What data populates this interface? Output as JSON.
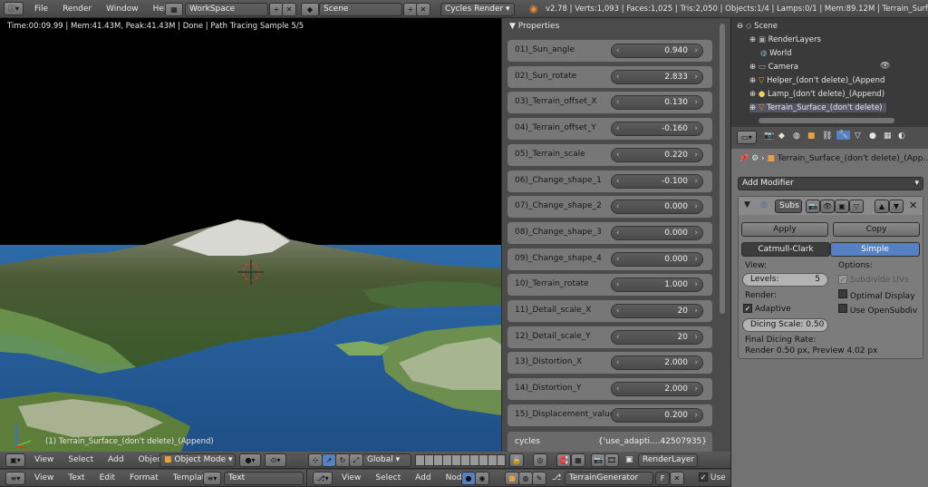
{
  "topbar": {
    "menus": [
      "File",
      "Render",
      "Window",
      "Help"
    ],
    "workspace": "WorkSpace",
    "scene": "Scene",
    "engine": "Cycles Render",
    "stats": "v2.78 | Verts:1,093 | Faces:1,025 | Tris:2,050 | Objects:1/4 | Lamps:0/1 | Mem:89.12M | Terrain_Surface_(don"
  },
  "viewport": {
    "info": "Time:00:09.99 | Mem:41.43M, Peak:41.43M | Done | Path Tracing Sample 5/5",
    "object_label": "(1) Terrain_Surface_(don't delete)_(Append)"
  },
  "props": {
    "title": "Properties",
    "rows": [
      {
        "label": "01)_Sun_angle",
        "value": "0.940"
      },
      {
        "label": "02)_Sun_rotate",
        "value": "2.833"
      },
      {
        "label": "03)_Terrain_offset_X",
        "value": "0.130"
      },
      {
        "label": "04)_Terrain_offset_Y",
        "value": "-0.160"
      },
      {
        "label": "05)_Terrain_scale",
        "value": "0.220"
      },
      {
        "label": "06)_Change_shape_1",
        "value": "-0.100"
      },
      {
        "label": "07)_Change_shape_2",
        "value": "0.000"
      },
      {
        "label": "08)_Change_shape_3",
        "value": "0.000"
      },
      {
        "label": "09)_Change_shape_4",
        "value": "0.000"
      },
      {
        "label": "10)_Terrain_rotate",
        "value": "1.000"
      },
      {
        "label": "11)_Detail_scale_X",
        "value": "20"
      },
      {
        "label": "12)_Detail_scale_Y",
        "value": "20"
      },
      {
        "label": "13)_Distortion_X",
        "value": "2.000"
      },
      {
        "label": "14)_Distortion_Y",
        "value": "2.000"
      },
      {
        "label": "15)_Displacement_value",
        "value": "0.200"
      }
    ],
    "cycles_label": "cycles",
    "cycles_value": "{'use_adapti....42507935}"
  },
  "viewheader": {
    "menus": [
      "View",
      "Select",
      "Add",
      "Object"
    ],
    "mode": "Object Mode",
    "orientation": "Global",
    "renderlayer": "RenderLayer"
  },
  "textheader": {
    "menus": [
      "View",
      "Text",
      "Edit",
      "Format",
      "Templates"
    ],
    "textname": "Text"
  },
  "nodeheader": {
    "menus": [
      "View",
      "Select",
      "Add",
      "Node"
    ],
    "nodename": "TerrainGenerator",
    "fake": "F",
    "use": "Use"
  },
  "outliner": {
    "items": [
      "Scene",
      "RenderLayers",
      "World",
      "Camera",
      "Helper_(don't delete)_(Append",
      "Lamp_(don't delete)_(Append)",
      "Terrain_Surface_(don't delete)"
    ]
  },
  "modifier": {
    "breadcrumb": "Terrain_Surface_(don't delete)_(App...",
    "add_modifier": "Add Modifier",
    "name": "Subs",
    "apply": "Apply",
    "copy": "Copy",
    "tab_cc": "Catmull-Clark",
    "tab_simple": "Simple",
    "view_label": "View:",
    "levels": "Levels:",
    "levels_value": "5",
    "render_label": "Render:",
    "adaptive": "Adaptive",
    "dicing": "Dicing Scale:",
    "dicing_value": "0.50",
    "options_label": "Options:",
    "subdivide_uvs": "Subdivide UVs",
    "optimal_display": "Optimal Display",
    "use_opensubdiv": "Use OpenSubdiv",
    "final_rate_label": "Final Dicing Rate:",
    "final_rate_value": "Render 0.50 px, Preview 4.02 px"
  }
}
